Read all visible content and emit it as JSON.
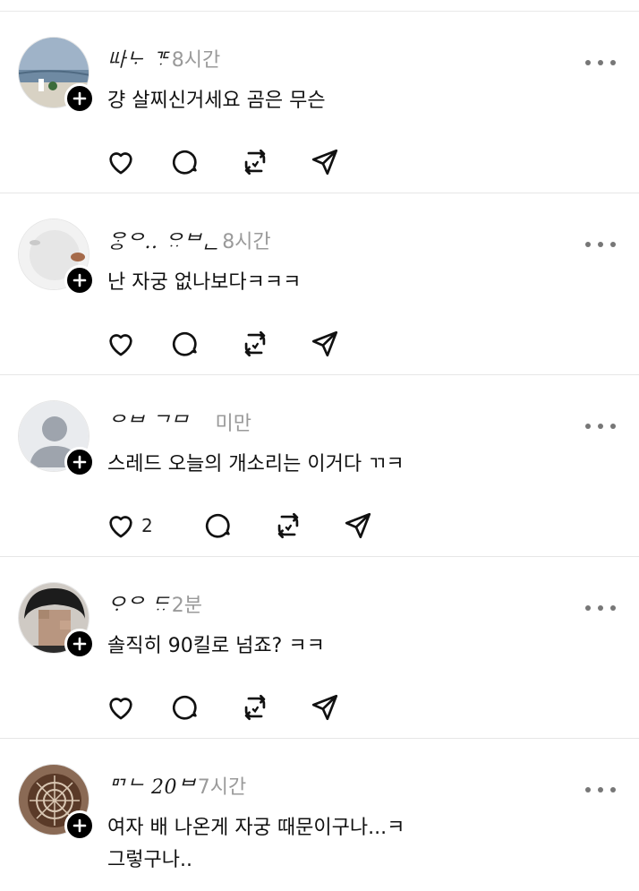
{
  "colors": {
    "icon": "#111111",
    "timestamp": "#9a9a9a",
    "badge": "#000000",
    "divider": "#e6e6e6"
  },
  "posts": [
    {
      "username": "ᄔᅡᄂᆞ ᄀᄃᆞ",
      "timestamp": "8시간",
      "content": "걍 살찌신거세요 곰은 무슨",
      "like_count": "",
      "avatar": "landscape-photo"
    },
    {
      "username": "ᄋᆞᆼᄋ.. ᄋᆢᄇᆫ",
      "timestamp": "8시간",
      "content": "난 자궁 없나보다ㅋㅋㅋ",
      "like_count": "",
      "avatar": "gray-circle-photo"
    },
    {
      "username": "ᄋᄇ ᄀᄆ",
      "timestamp": "미만",
      "content": "스레드 오늘의 개소리는 이거다 ㄲㅋ",
      "like_count": "2",
      "avatar": "default-person"
    },
    {
      "username": "ᄋᆞᄋ ᄃᆢ",
      "timestamp": "2분",
      "content": "솔직히 90킬로 넘죠? ㅋㅋ",
      "like_count": "",
      "avatar": "blurred-face-photo"
    },
    {
      "username": "ᄆᄀᄂ 20ᄇ",
      "timestamp": "7시간",
      "content": "여자 배 나온게 자궁 때문이구나...ㅋ\n그렇구나..",
      "like_count": "",
      "avatar": "latte-art-photo"
    }
  ]
}
